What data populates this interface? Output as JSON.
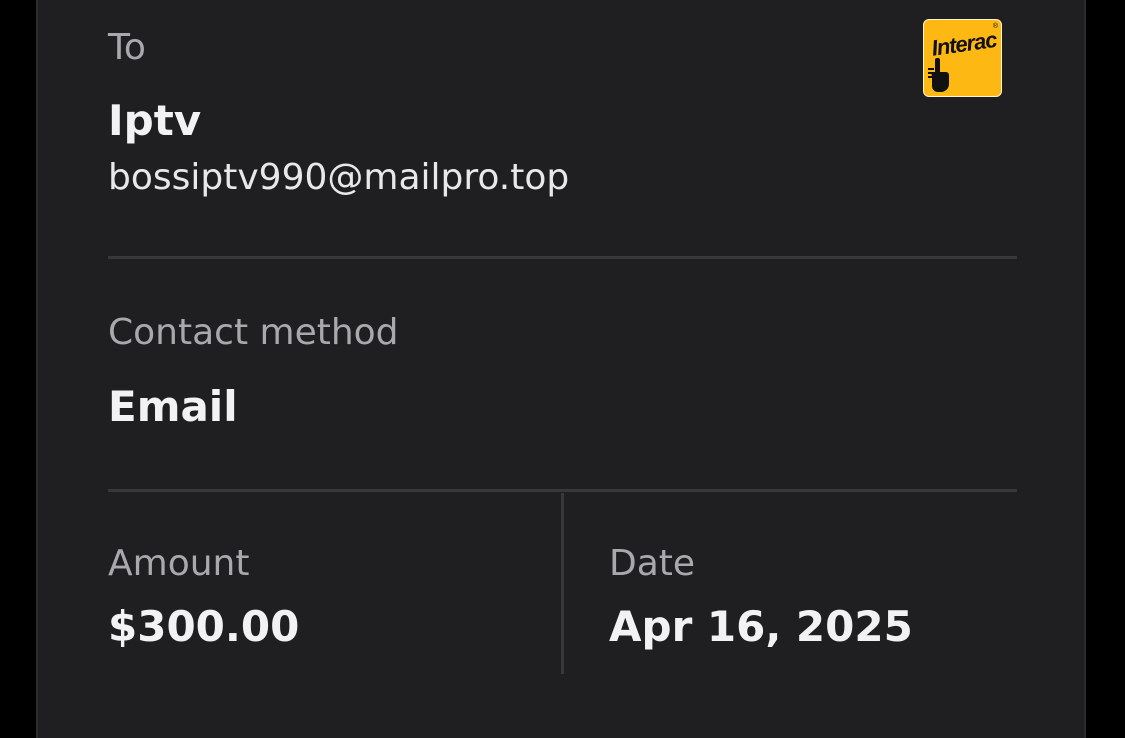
{
  "recipient": {
    "section_label": "To",
    "name": "Iptv",
    "email": "bossiptv990@mailpro.top"
  },
  "contact": {
    "label": "Contact method",
    "value": "Email"
  },
  "amount": {
    "label": "Amount",
    "value": "$300.00"
  },
  "date": {
    "label": "Date",
    "value": "Apr 16, 2025"
  },
  "logo": {
    "text": "Interac",
    "icon": "interac-hand-icon",
    "brand_color": "#fdb813"
  },
  "colors": {
    "background": "#1f1f21",
    "label": "#a9a9ad",
    "value": "#f2f2f4",
    "divider": "#38383a"
  }
}
